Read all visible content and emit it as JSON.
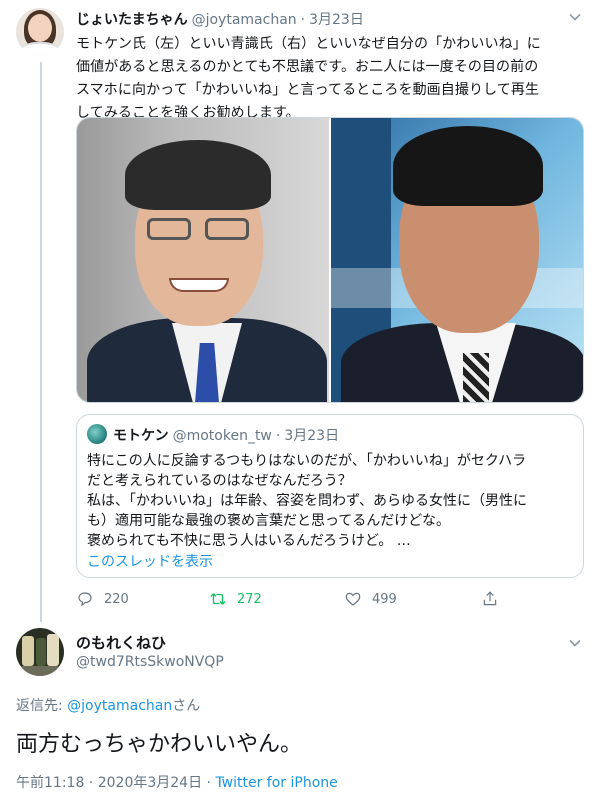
{
  "tweet": {
    "display_name": "じょいたまちゃん",
    "handle": "@joytamachan",
    "separator": "·",
    "date": "3月23日",
    "text_lines": [
      "モトケン氏（左）といい青識氏（右）といいなぜ自分の「かわいいね」に",
      "価値があると思えるのかとても不思議です。お二人には一度その目の前の",
      "スマホに向かって「かわいいね」と言ってるところを動画自撮りして再生",
      "してみることを強くお勧めします。"
    ],
    "media_icon": "photo-image-icon",
    "quote": {
      "display_name": "モトケン",
      "handle": "@motoken_tw",
      "separator": "·",
      "date": "3月23日",
      "text_lines": [
        "特にこの人に反論するつもりはないのだが、「かわいいね」がセクハラ",
        "だと考えられているのはなぜなんだろう？",
        "私は、「かわいいね」は年齢、容姿を問わず、あらゆる女性に（男性に",
        "も）適用可能な最強の褒め言葉だと思ってるんだけどな。",
        "褒められても不快に思う人はいるんだろうけど。 …"
      ],
      "show_thread": "このスレッドを表示"
    },
    "actions": {
      "reply_count": "220",
      "retweet_count": "272",
      "like_count": "499"
    },
    "colors": {
      "retweet": "#17bf63",
      "link": "#1b95e0",
      "muted": "#657786"
    }
  },
  "reply": {
    "display_name": "のもれくねひ",
    "handle": "@twd7RtsSkwoNVQP",
    "replying_to_label": "返信先: ",
    "replying_to_mention": "@joytamachan",
    "replying_to_suffix": "さん",
    "text": "両方むっちゃかわいいやん。",
    "time": "午前11:18",
    "separator": " · ",
    "date": "2020年3月24日",
    "source": "Twitter for iPhone"
  },
  "icons": {
    "caret": "chevron-down-icon",
    "reply": "reply-bubble-icon",
    "retweet": "retweet-icon",
    "like": "heart-icon",
    "share": "share-icon"
  }
}
